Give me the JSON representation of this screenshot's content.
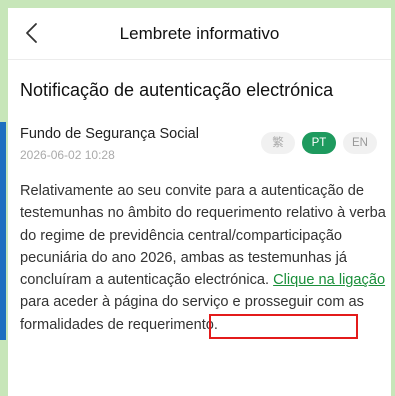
{
  "header": {
    "title": "Lembrete informativo"
  },
  "notification": {
    "title": "Notificação de autenticação electrónica",
    "sender": "Fundo de Segurança Social",
    "date": "2026-06-02 10:28"
  },
  "languages": [
    {
      "label": "繁",
      "selected": false
    },
    {
      "label": "PT",
      "selected": true
    },
    {
      "label": "EN",
      "selected": false
    }
  ],
  "message": {
    "text_before": "Relativamente ao seu convite para a autenticação de testemunhas no âmbito do requerimento relativo à verba do regime de previdência central/comparticipação pecuniária do ano 2026, ambas as testemunhas já concluíram a autenticação electrónica. ",
    "link_text": "Clique na ligação",
    "text_after": " para aceder à página do serviço e prosseguir com as formalidades de requerimento."
  },
  "colors": {
    "accent": "#1e9a5e",
    "link": "#1a8f3a",
    "highlight_border": "#e31b1b",
    "background": "#c7e6b9"
  },
  "icons": {
    "back": "chevron-left-icon"
  }
}
